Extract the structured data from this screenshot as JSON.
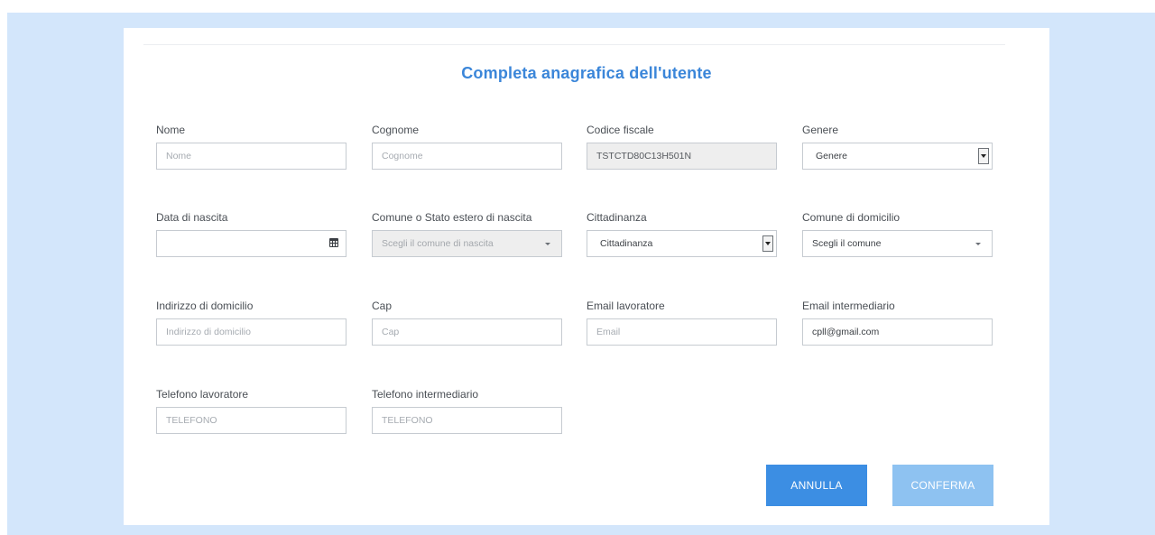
{
  "form": {
    "title": "Completa anagrafica dell'utente",
    "fields": {
      "nome": {
        "label": "Nome",
        "placeholder": "Nome",
        "value": ""
      },
      "cognome": {
        "label": "Cognome",
        "placeholder": "Cognome",
        "value": ""
      },
      "codice_fiscale": {
        "label": "Codice fiscale",
        "value": "TSTCTD80C13H501N"
      },
      "genere": {
        "label": "Genere",
        "selected": "Genere"
      },
      "data_nascita": {
        "label": "Data di nascita",
        "value": ""
      },
      "comune_nascita": {
        "label": "Comune o Stato estero di nascita",
        "placeholder": "Scegli il comune di nascita"
      },
      "cittadinanza": {
        "label": "Cittadinanza",
        "selected": "Cittadinanza"
      },
      "comune_domicilio": {
        "label": "Comune di domicilio",
        "placeholder": "Scegli il comune"
      },
      "indirizzo_domicilio": {
        "label": "Indirizzo di domicilio",
        "placeholder": "Indirizzo di domicilio",
        "value": ""
      },
      "cap": {
        "label": "Cap",
        "placeholder": "Cap",
        "value": ""
      },
      "email_lavoratore": {
        "label": "Email lavoratore",
        "placeholder": "Email",
        "value": ""
      },
      "email_intermediario": {
        "label": "Email intermediario",
        "value": "cpll@gmail.com"
      },
      "telefono_lavoratore": {
        "label": "Telefono lavoratore",
        "placeholder": "TELEFONO",
        "value": ""
      },
      "telefono_intermediario": {
        "label": "Telefono intermediario",
        "placeholder": "TELEFONO",
        "value": ""
      }
    },
    "buttons": {
      "annulla": "ANNULLA",
      "conferma": "CONFERMA"
    }
  },
  "icons": {
    "calendar": "calendar-icon",
    "dropdown": "chevron-down-icon"
  },
  "colors": {
    "background": "#d3e6fb",
    "title": "#3b86d9",
    "primary_button": "#3c8ee3",
    "disabled_button": "#8ec2f1"
  }
}
